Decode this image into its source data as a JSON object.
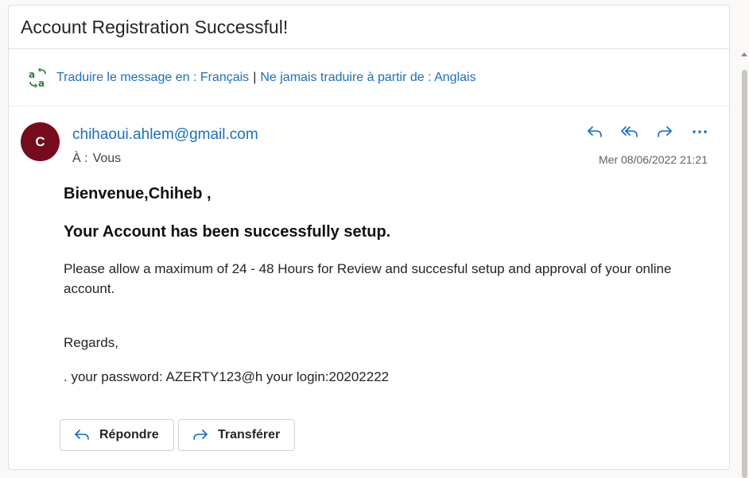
{
  "subject": "Account Registration Successful!",
  "translate": {
    "translate_link": "Traduire le message en : Français",
    "separator": "|",
    "never_link": "Ne jamais traduire à partir de : Anglais"
  },
  "message": {
    "avatar_initial": "C",
    "avatar_color": "#750b1c",
    "sender": "chihaoui.ahlem@gmail.com",
    "to_label": "À :",
    "to_value": "Vous",
    "date": "Mer 08/06/2022 21:21",
    "actions": [
      "reply-icon",
      "reply-all-icon",
      "forward-icon",
      "more-icon"
    ]
  },
  "body": {
    "greeting": "Bienvenue,Chiheb ,",
    "headline": "Your Account has been successfully setup.",
    "paragraph": "Please allow a maximum of 24 - 48 Hours for Review and succesful setup and approval of your online account.",
    "regards": "Regards,",
    "credentials": ". your password: AZERTY123@h your login:20202222"
  },
  "buttons": {
    "reply": "Répondre",
    "forward": "Transférer"
  },
  "colors": {
    "link": "#1d6fb8",
    "accent": "#0f6cbd"
  }
}
